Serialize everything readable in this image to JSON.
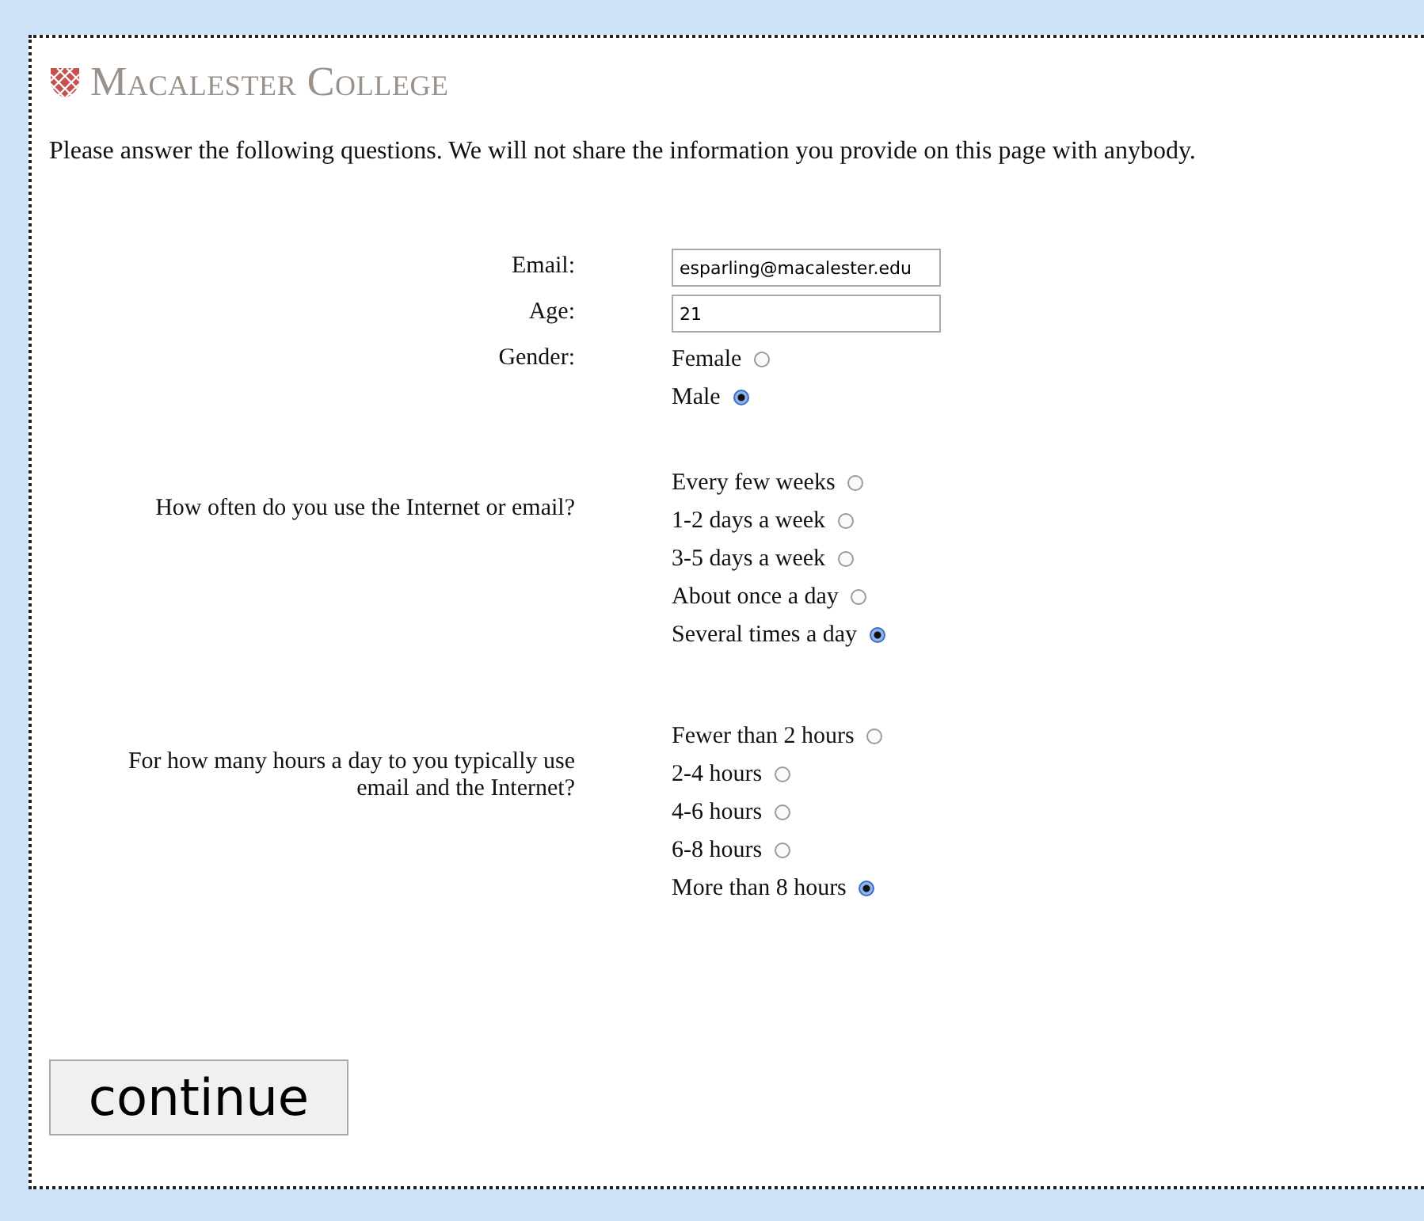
{
  "header": {
    "logo_text": "Macalester College"
  },
  "intro": "Please answer the following questions. We will not share the information you provide on this page with anybody.",
  "fields": [
    {
      "label": "Email:",
      "value": "esparling@macalester.edu"
    },
    {
      "label": "Age:",
      "value": "21"
    }
  ],
  "gender": {
    "label": "Gender:",
    "options": [
      {
        "label": "Female",
        "selected": false
      },
      {
        "label": "Male",
        "selected": true
      }
    ]
  },
  "questions": [
    {
      "label": "How often do you use the Internet or email?",
      "options": [
        {
          "label": "Every few weeks",
          "selected": false
        },
        {
          "label": "1-2 days a week",
          "selected": false
        },
        {
          "label": "3-5 days a week",
          "selected": false
        },
        {
          "label": "About once a day",
          "selected": false
        },
        {
          "label": "Several times a day",
          "selected": true
        }
      ]
    },
    {
      "label": "For how many hours a day to you typically use email and the Internet?",
      "options": [
        {
          "label": "Fewer than 2 hours",
          "selected": false
        },
        {
          "label": "2-4 hours",
          "selected": false
        },
        {
          "label": "4-6 hours",
          "selected": false
        },
        {
          "label": "6-8 hours",
          "selected": false
        },
        {
          "label": "More than 8 hours",
          "selected": true
        }
      ]
    }
  ],
  "button": "continue"
}
